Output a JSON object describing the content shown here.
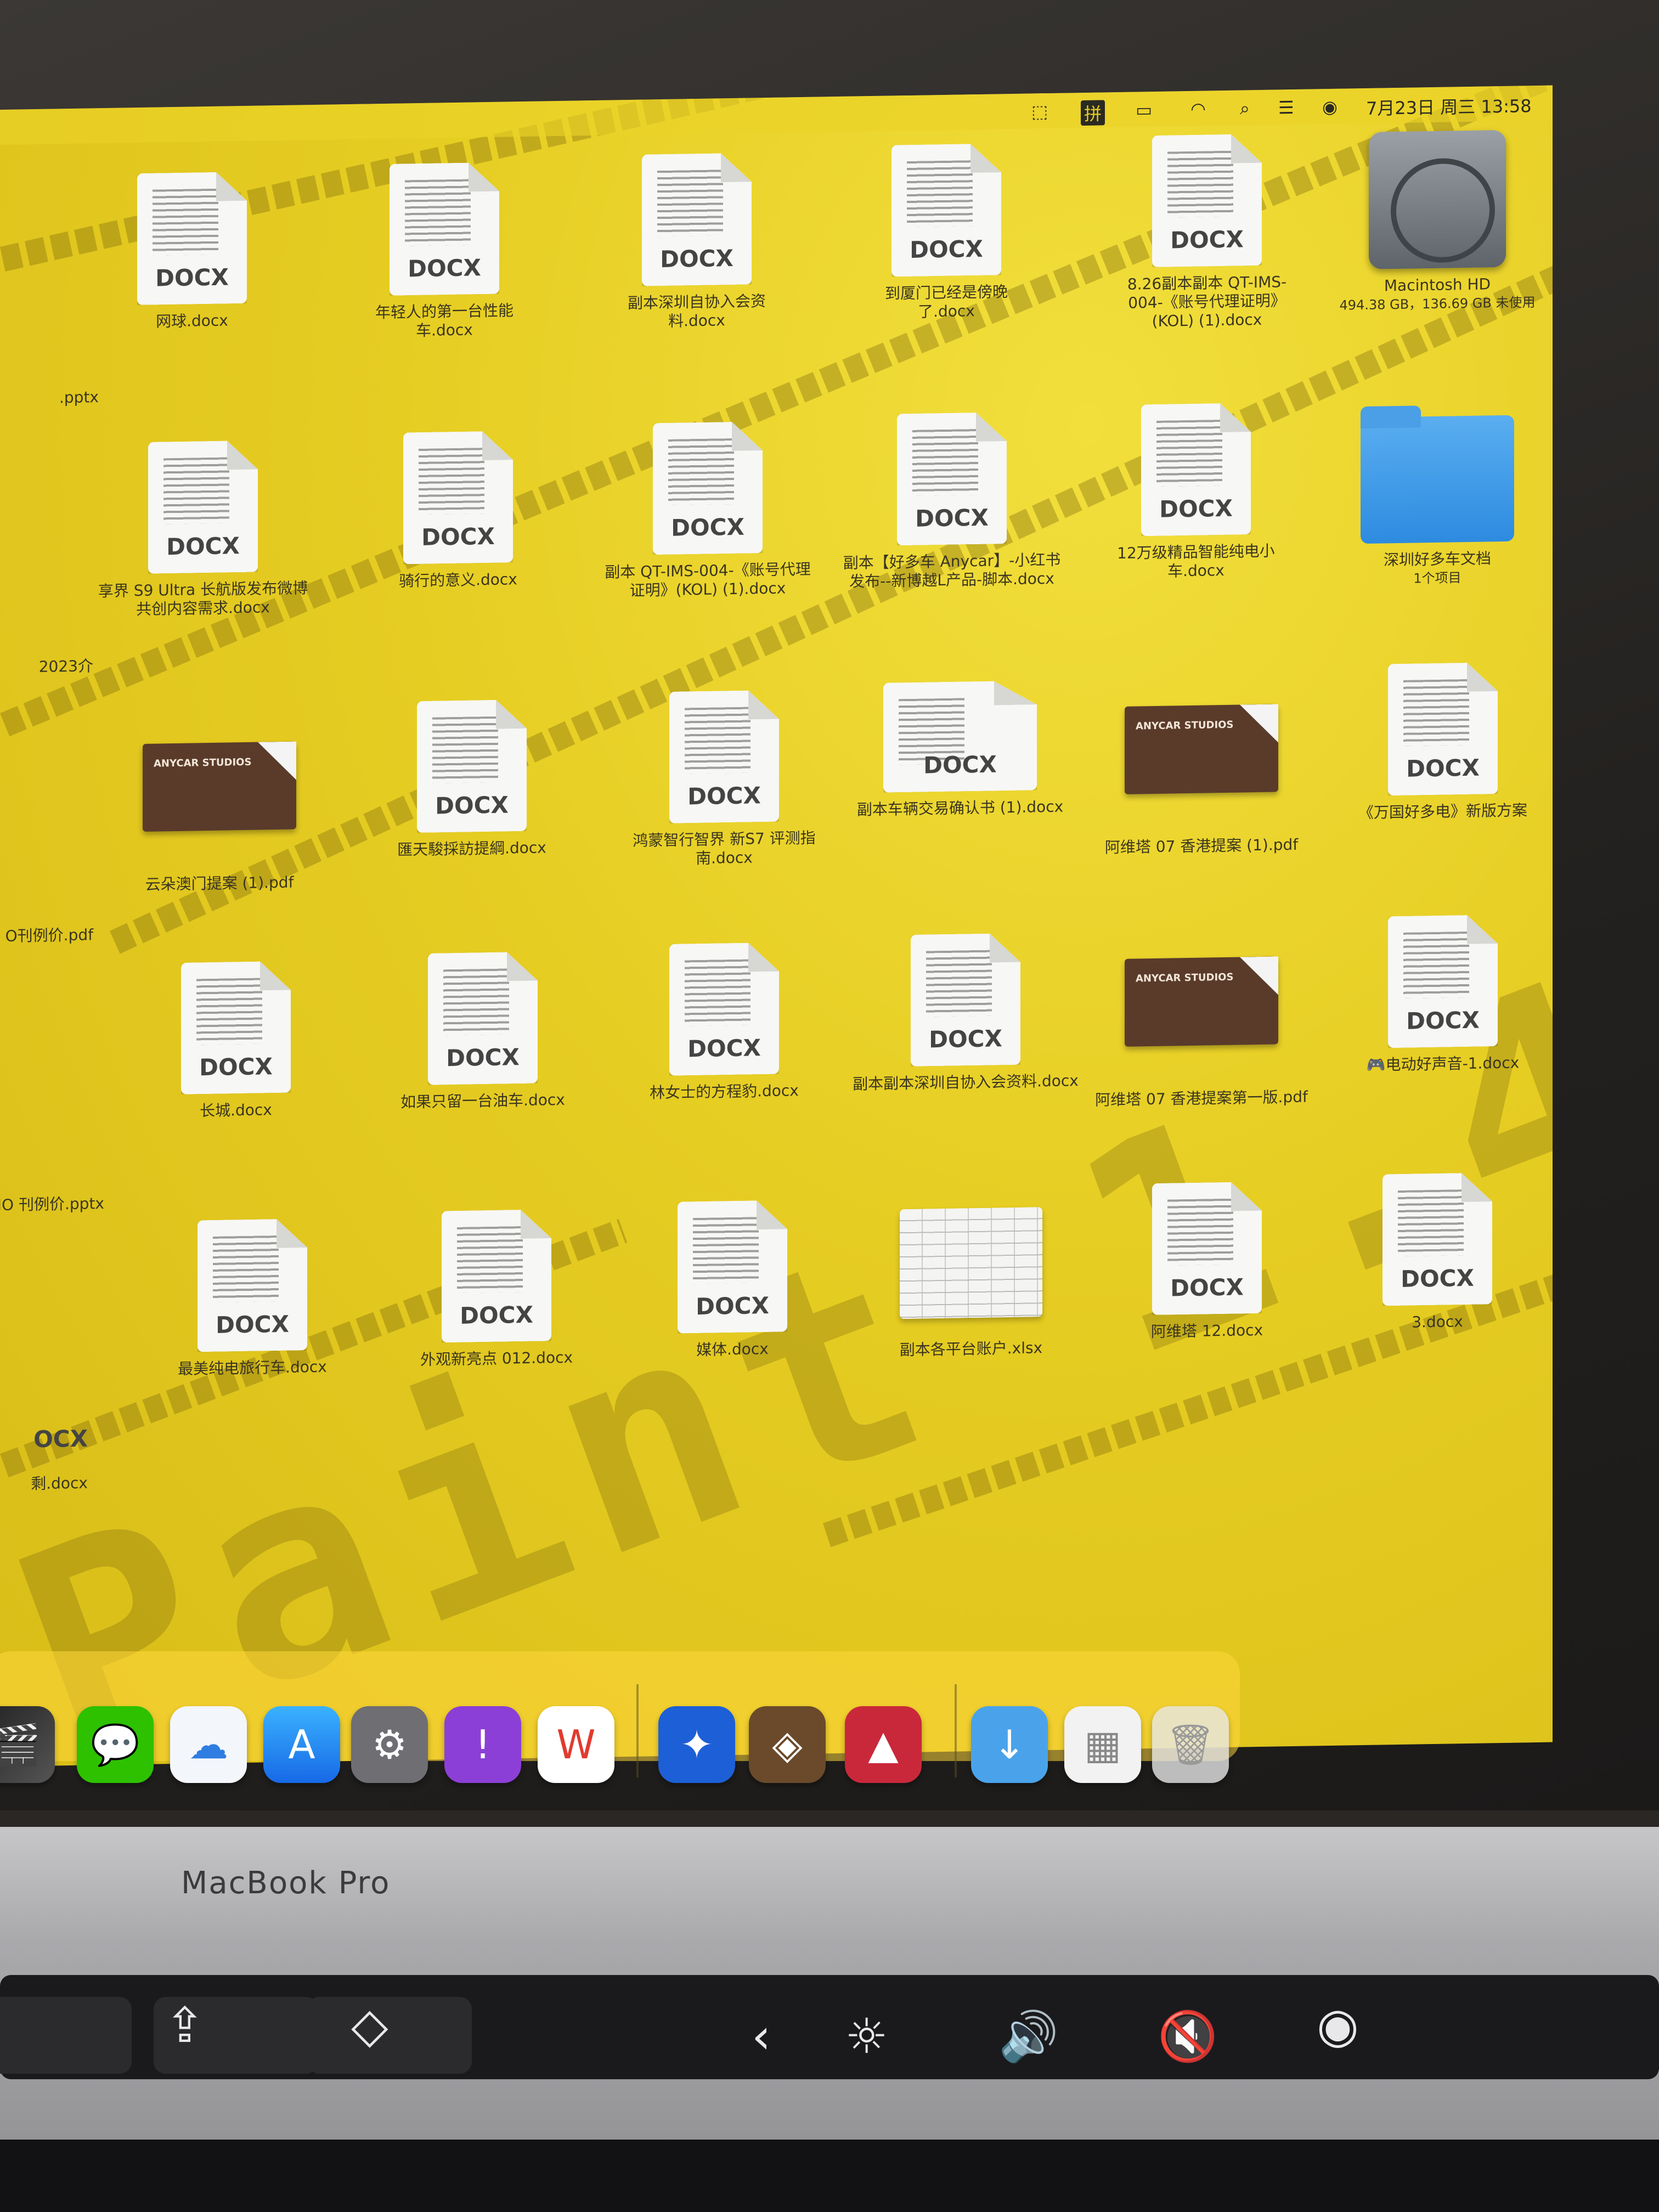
{
  "menubar": {
    "ime": "拼",
    "clock": "7月23日 周三 13:58"
  },
  "desktop": {
    "col0": [
      ".pptx",
      "2023介",
      "O刊例价.pdf",
      "IO 刊例价.pptx",
      "OCX",
      "剩.docx"
    ],
    "items": [
      {
        "type": "DOCX",
        "name": "网球.docx"
      },
      {
        "type": "DOCX",
        "name": "年轻人的第一台性能车.docx"
      },
      {
        "type": "DOCX",
        "name": "副本深圳自协入会资料.docx"
      },
      {
        "type": "DOCX",
        "name": "到厦门已经是傍晚了.docx"
      },
      {
        "type": "DOCX",
        "name": "8.26副本副本 QT-IMS-004-《账号代理证明》(KOL) (1).docx"
      },
      {
        "type": "DOCX",
        "name": "享界 S9 Ultra 长航版发布微博共创内容需求.docx"
      },
      {
        "type": "DOCX",
        "name": "骑行的意义.docx"
      },
      {
        "type": "DOCX",
        "name": "副本 QT-IMS-004-《账号代理证明》(KOL) (1).docx"
      },
      {
        "type": "DOCX",
        "name": "副本【好多车 Anycar】-小红书发布--新博越L产品-脚本.docx"
      },
      {
        "type": "DOCX",
        "name": "12万级精品智能纯电小车.docx"
      },
      {
        "type": "PDF",
        "name": "云朵澳门提案 (1).pdf"
      },
      {
        "type": "DOCX",
        "name": "匯天駿採訪提綱.docx"
      },
      {
        "type": "DOCX",
        "name": "鸿蒙智行智界 新S7 评测指南.docx"
      },
      {
        "type": "DOCX",
        "name": "副本车辆交易确认书 (1).docx"
      },
      {
        "type": "PDF",
        "name": "阿维塔 07 香港提案 (1).pdf"
      },
      {
        "type": "DOCX",
        "name": "《万国好多电》新版方案"
      },
      {
        "type": "DOCX",
        "name": "长城.docx"
      },
      {
        "type": "DOCX",
        "name": "如果只留一台油车.docx"
      },
      {
        "type": "DOCX",
        "name": "林女士的方程豹.docx"
      },
      {
        "type": "DOCX",
        "name": "副本副本深圳自协入会资料.docx"
      },
      {
        "type": "PDF",
        "name": "阿维塔 07 香港提案第一版.pdf"
      },
      {
        "type": "DOCX",
        "name": "🎮电动好声音-1.docx"
      },
      {
        "type": "DOCX",
        "name": "最美纯电旅行车.docx"
      },
      {
        "type": "DOCX",
        "name": "外观新亮点 012.docx"
      },
      {
        "type": "DOCX",
        "name": "媒体.docx"
      },
      {
        "type": "XLSX",
        "name": "副本各平台账户.xlsx"
      },
      {
        "type": "DOCX",
        "name": "阿维塔 12.docx"
      },
      {
        "type": "DOCX",
        "name": "3.docx"
      }
    ],
    "pdf_card_text": "ANYCAR\nSTUDIOS",
    "drive": {
      "name": "Macintosh HD",
      "info": "494.38 GB，136.69 GB 未使用"
    },
    "folder": {
      "name": "深圳好多车文档",
      "info": "1个项目"
    }
  },
  "wallpaper_text": "Paint 1.4",
  "macbook_label": "MacBook Pro",
  "dock": {
    "apps": [
      "final-cut-pro",
      "wechat",
      "baidu-netdisk",
      "app-store",
      "system-settings",
      "feedback",
      "wps-office",
      "arc-browser",
      "hearthstone",
      "app-red",
      "downloads-folder",
      "screenshot-thumb",
      "trash"
    ]
  },
  "touchbar": {
    "icons": [
      "chevron-left",
      "brightness",
      "volume",
      "mute",
      "siri"
    ]
  },
  "colors": {
    "wallpaper": "#e6cd22",
    "folder": "#3a96e6",
    "pdf_card": "#5a3b2a"
  }
}
